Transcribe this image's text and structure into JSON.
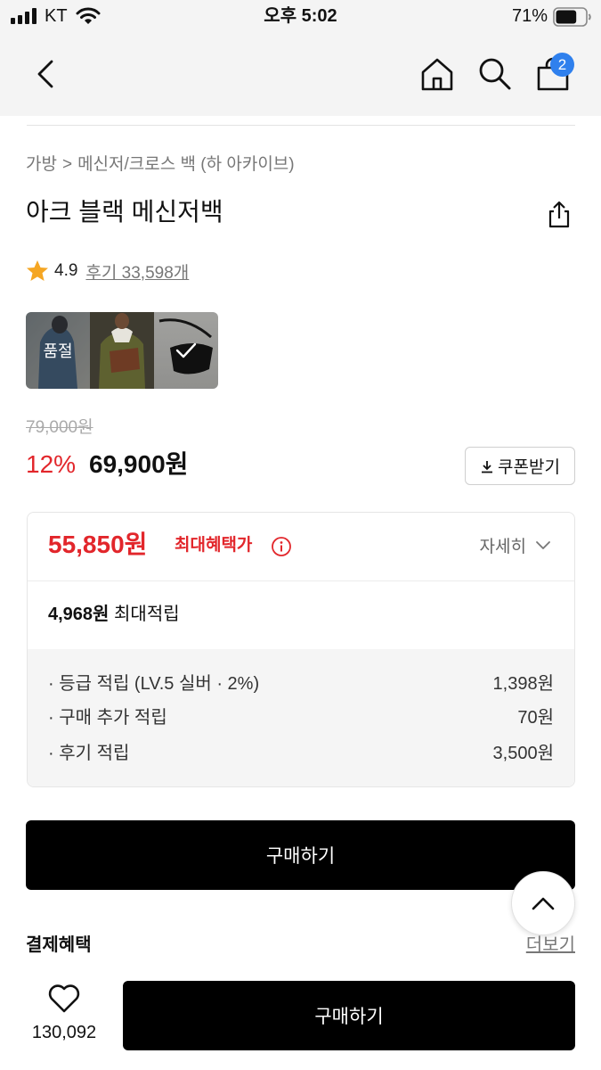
{
  "status_bar": {
    "carrier": "KT",
    "time": "오후 5:02",
    "battery": "71%",
    "battery_level": 0.71
  },
  "nav": {
    "cart_count": "2"
  },
  "breadcrumb": {
    "category": "가방",
    "separator": ">",
    "subcategory": "메신저/크로스 백 (하 아카이브)"
  },
  "product": {
    "title": "아크 블랙 메신저백",
    "rating": "4.9",
    "reviews": "후기 33,598개",
    "options": [
      {
        "badge": "품절"
      },
      {
        "badge": ""
      },
      {
        "badge": "",
        "selected": true
      }
    ],
    "original_price": "79,000원",
    "discount_rate": "12%",
    "sale_price": "69,900원",
    "coupon_label": "쿠폰받기"
  },
  "benefit": {
    "max_price": "55,850원",
    "max_price_label": "최대혜택가",
    "detail_label": "자세히",
    "max_points": "4,968원",
    "max_points_label": "최대적립",
    "rows": [
      {
        "label": "· 등급 적립 (LV.5 실버 · 2%)",
        "value": "1,398원"
      },
      {
        "label": "· 구매 추가 적립",
        "value": "70원"
      },
      {
        "label": "· 후기 적립",
        "value": "3,500원"
      }
    ]
  },
  "buy_label": "구매하기",
  "payment": {
    "title": "결제혜택",
    "more_label": "더보기"
  },
  "bottom_bar": {
    "like_count": "130,092",
    "buy_label": "구매하기"
  },
  "colors": {
    "accent_red": "#e2262b",
    "badge_blue": "#2f80ed",
    "button_black": "#000000",
    "star": "#f5a623"
  },
  "icons": [
    "signal-icon",
    "wifi-icon",
    "battery-icon",
    "back-chevron-icon",
    "home-icon",
    "search-icon",
    "shopping-bag-icon",
    "share-icon",
    "star-icon",
    "download-icon",
    "info-icon",
    "chevron-down-icon",
    "check-icon",
    "chevron-up-icon",
    "heart-icon"
  ]
}
